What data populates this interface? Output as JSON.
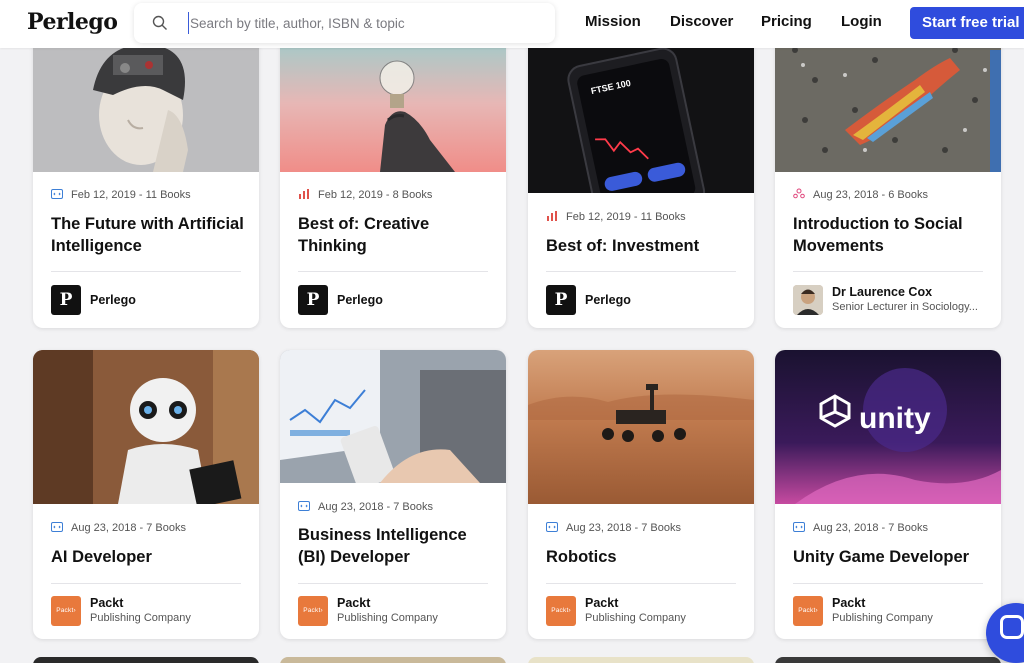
{
  "header": {
    "logo": "Perlego",
    "search_placeholder": "Search by title, author, ISBN & topic",
    "nav": [
      "Mission",
      "Discover",
      "Pricing",
      "Login"
    ],
    "cta": "Start free trial"
  },
  "cards": [
    {
      "date": "Feb 12, 2019 - 11 Books",
      "title": "The Future with Artificial Intelligence",
      "publisher": "Perlego",
      "publisher_sub": ""
    },
    {
      "date": "Feb 12, 2019 - 8 Books",
      "title": "Best of: Creative Thinking",
      "publisher": "Perlego",
      "publisher_sub": ""
    },
    {
      "date": "Feb 12, 2019 - 11 Books",
      "title": "Best of: Investment",
      "publisher": "Perlego",
      "publisher_sub": ""
    },
    {
      "date": "Aug 23, 2018 - 6 Books",
      "title": "Introduction to Social Movements",
      "publisher": "Dr Laurence Cox",
      "publisher_sub": "Senior Lecturer in Sociology..."
    },
    {
      "date": "Aug 23, 2018 - 7 Books",
      "title": "AI Developer",
      "publisher": "Packt",
      "publisher_sub": "Publishing Company"
    },
    {
      "date": "Aug 23, 2018 - 7 Books",
      "title": "Business Intelligence (BI) Developer",
      "publisher": "Packt",
      "publisher_sub": "Publishing Company"
    },
    {
      "date": "Aug 23, 2018 - 7 Books",
      "title": "Robotics",
      "publisher": "Packt",
      "publisher_sub": "Publishing Company"
    },
    {
      "date": "Aug 23, 2018 - 7 Books",
      "title": "Unity Game Developer",
      "publisher": "Packt",
      "publisher_sub": "Publishing Company"
    }
  ],
  "badges": {
    "perlego_letter": "P",
    "packt_logo": "Packt›"
  },
  "images": {
    "ftse_label": "FTSE 100",
    "unity_logo": "unity"
  },
  "colors": {
    "brand_blue": "#2f4cdd",
    "packt_orange": "#e8793c",
    "meta_icon_blue": "#3d7fd6",
    "meta_icon_red": "#e0524b",
    "meta_icon_pink": "#e0457b"
  }
}
